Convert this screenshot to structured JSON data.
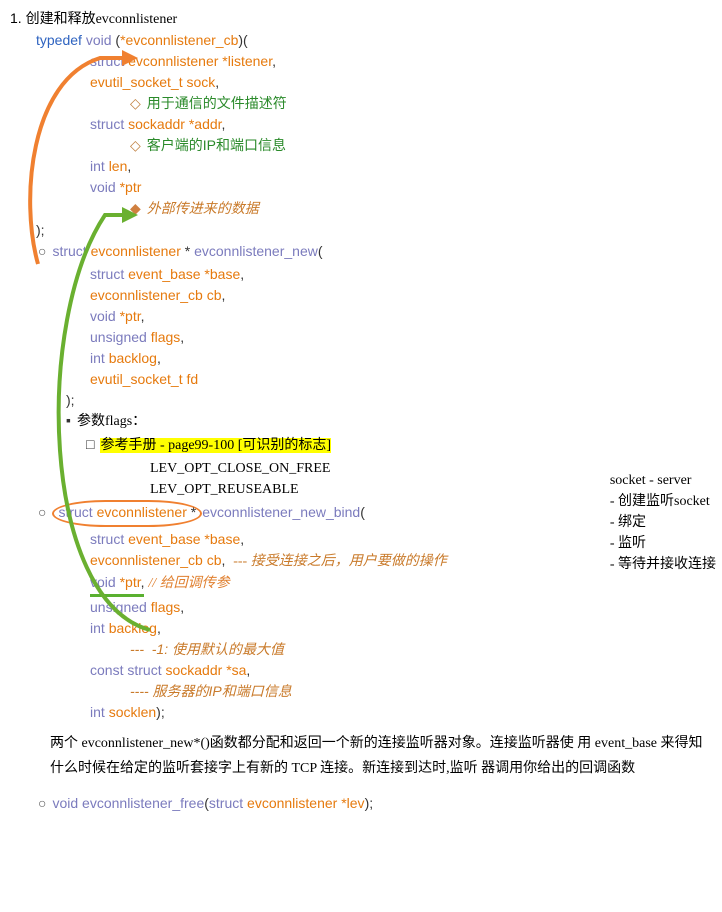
{
  "title": {
    "num": "1.",
    "text": "创建和释放evconnlistener"
  },
  "typedef": {
    "line": "typedef void (*evconnlistener_cb)(",
    "p1": "struct evconnlistener *listener,",
    "p2": "evutil_socket_t sock,",
    "p2_note": "用于通信的文件描述符",
    "p3": "struct sockaddr *addr,",
    "p3_note": "客户端的IP和端口信息",
    "p4": "int len,",
    "p5": "void *ptr",
    "p5_note": "外部传进来的数据",
    "close": ");"
  },
  "fn1": {
    "sig": "struct evconnlistener * evconnlistener_new(",
    "p1": "struct event_base *base,",
    "p2": "evconnlistener_cb cb,",
    "p3": "void *ptr,",
    "p4": "unsigned flags,",
    "p5": "int backlog,",
    "p6": "evutil_socket_t fd",
    "close": ");",
    "flags_label": "参数flags：",
    "flags_ref": "参考手册 - page99-100 [可识别的标志]",
    "opt1": "LEV_OPT_CLOSE_ON_FREE",
    "opt2": "LEV_OPT_REUSEABLE"
  },
  "fn2": {
    "sig_pre": "struct evconnlistener *",
    "sig_name": "evconnlistener_new_bind(",
    "p1": "struct event_base *base,",
    "p2": "evconnlistener_cb cb,",
    "p2_note": "--- 接受连接之后，用户要做的操作",
    "p3": "void *ptr,",
    "p3_note": "// 给回调传参",
    "p4": "unsigned flags,",
    "p5": "int backlog,",
    "p5_note": "---  -1: 使用默认的最大值",
    "p6": "const struct sockaddr *sa,",
    "p6_note": "---- 服务器的IP和端口信息",
    "p7": "int socklen);",
    "close": ""
  },
  "explain": "两个 evconnlistener_new*()函数都分配和返回一个新的连接监听器对象。连接监听器使 用 event_base 来得知什么时候在给定的监听套接字上有新的 TCP 连接。新连接到达时,监听 器调用你给出的回调函数",
  "fn3": "void evconnlistener_free(struct evconnlistener *lev);",
  "sidebar": {
    "title": "socket - server",
    "items": [
      "创建监听socket",
      "绑定",
      "监听",
      "等待并接收连接"
    ]
  }
}
